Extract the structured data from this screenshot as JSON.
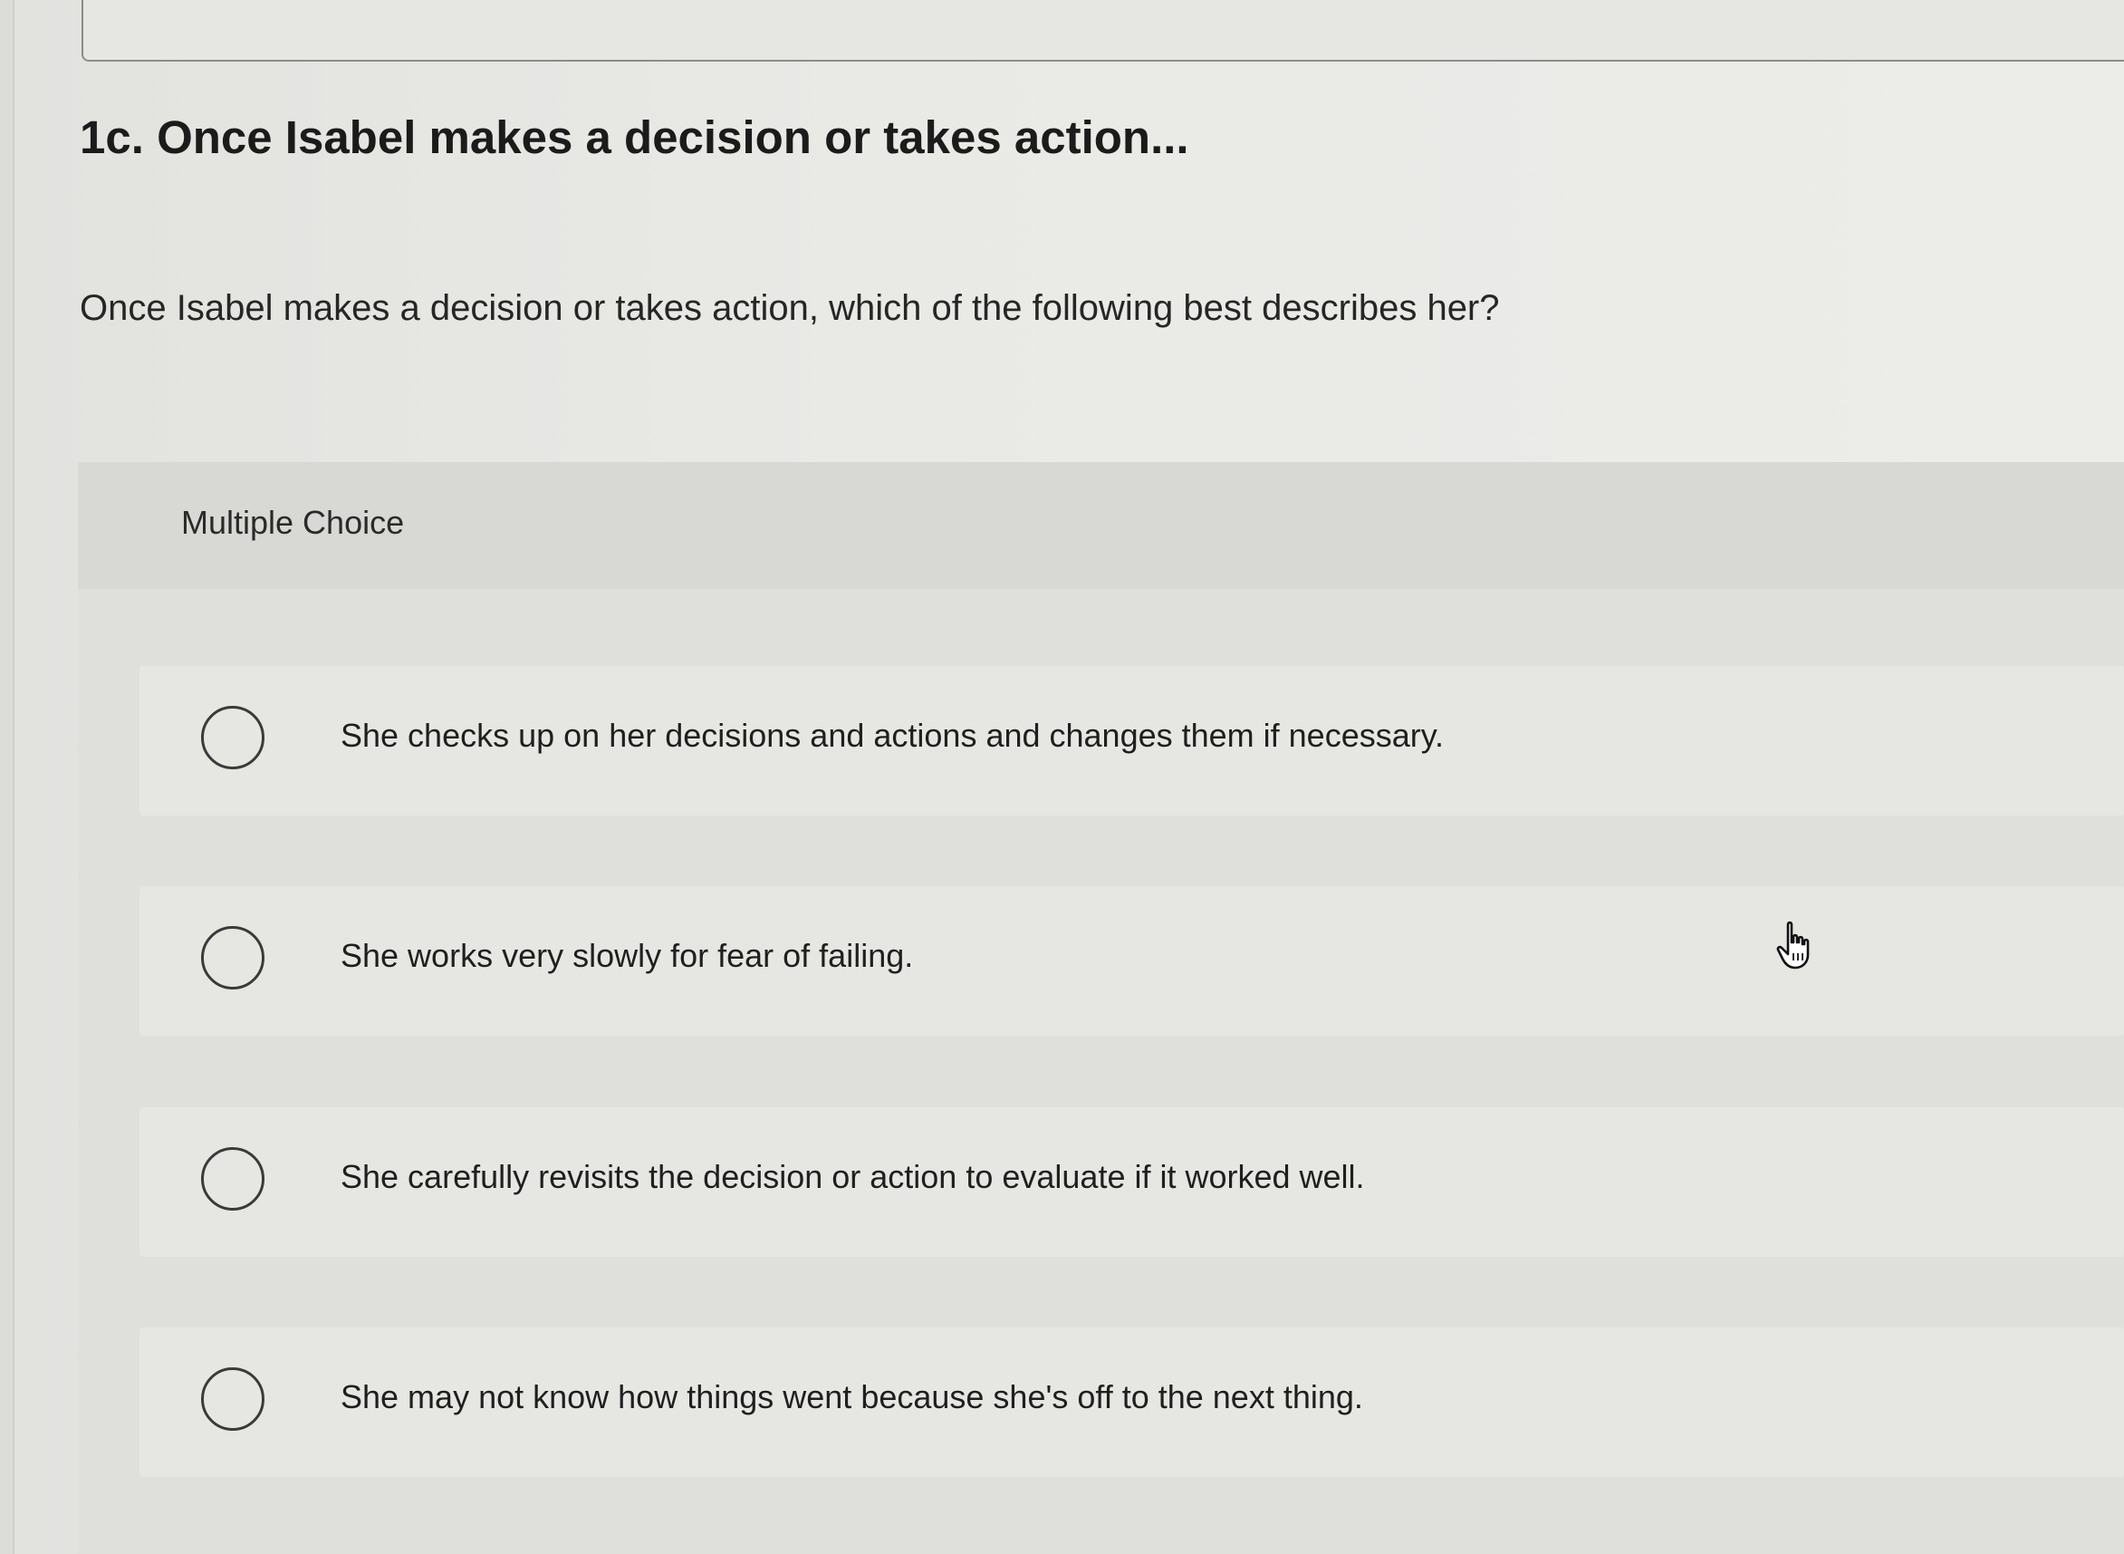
{
  "question": {
    "title": "1c. Once Isabel makes a decision or takes action...",
    "prompt": "Once Isabel makes a decision or takes action, which of the following best describes her?"
  },
  "multiple_choice": {
    "label": "Multiple Choice",
    "options": [
      {
        "label": "She checks up on her decisions and actions and changes them if necessary.",
        "selected": false
      },
      {
        "label": "She works very slowly for fear of failing.",
        "selected": false
      },
      {
        "label": "She carefully revisits the decision or action to evaluate if it worked well.",
        "selected": false
      },
      {
        "label": "She may not know how things went because she's off to the next thing.",
        "selected": false
      }
    ]
  },
  "icons": {
    "radio": "radio-button-unselected-icon",
    "cursor": "hand-pointer-cursor-icon"
  },
  "colors": {
    "background": "#e7e7e4",
    "panel": "#dfdfdc",
    "text": "#1d1d1d",
    "radio_border": "#3a3a3a"
  }
}
